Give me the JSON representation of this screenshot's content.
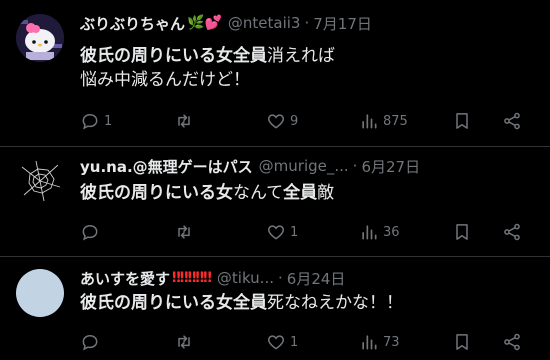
{
  "posts": [
    {
      "name": "ぶりぶりちゃん",
      "name_emoji": "🌿💕",
      "handle": "@ntetaii3",
      "date": "7月17日",
      "text_bold": "彼氏の周りにいる女全員",
      "text_rest": "消えれば",
      "text_line2": "悩み中減るんだけど！",
      "reply_count": "1",
      "retweet_count": "",
      "like_count": "9",
      "view_count": "875"
    },
    {
      "name": "yu.na.@無理ゲーはパス",
      "handle": "@murige_...",
      "date": "6月27日",
      "text_bold": "彼氏の周りにいる女",
      "text_mid": "なんて",
      "text_bold2": "全員",
      "text_rest": "敵",
      "reply_count": "",
      "retweet_count": "",
      "like_count": "1",
      "view_count": "36"
    },
    {
      "name": "あいすを愛す",
      "name_emoji": "‼‼‼‼‼",
      "handle": "@tiku...",
      "date": "6月24日",
      "text_bold": "彼氏の周りにいる女全員",
      "text_rest": "死なねえかな！！",
      "reply_count": "",
      "retweet_count": "",
      "like_count": "1",
      "view_count": "73"
    }
  ],
  "separator": "·",
  "colors": {
    "background": "#000000",
    "text": "#e7e9ea",
    "muted": "#71767b",
    "divider": "#2f3336",
    "bangs": "#ff2b2b"
  }
}
